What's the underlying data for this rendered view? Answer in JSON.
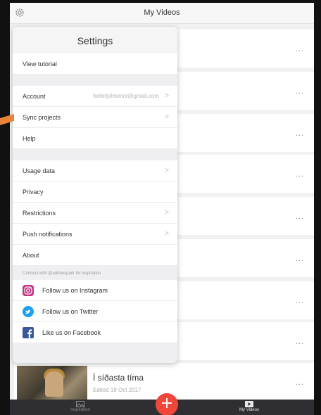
{
  "header": {
    "title": "My Videos"
  },
  "settings": {
    "title": "Settings",
    "items": {
      "tutorial": "View tutorial",
      "account": "Account",
      "account_email": "hellefjolmennt@gmail.com",
      "sync": "Sync projects",
      "help": "Help",
      "usage": "Usage data",
      "privacy": "Privacy",
      "restrictions": "Restrictions",
      "push": "Push notifications",
      "about": "About"
    },
    "connect_label": "Connect with @adobespark for inspiration",
    "social": {
      "instagram": "Follow us on Instagram",
      "twitter": "Follow us on Twitter",
      "facebook": "Like us on Facebook"
    }
  },
  "videos": {
    "more_label": "...",
    "last": {
      "title": "Í síðasta tíma",
      "date": "Edited 18 Oct 2017"
    }
  },
  "tabbar": {
    "inspiration": "Inspiration",
    "my_videos": "My Videos",
    "add_label": "+"
  },
  "colors": {
    "accent": "#f0473a",
    "tabbar": "#2f2f33",
    "annotation": "#e8833a"
  }
}
